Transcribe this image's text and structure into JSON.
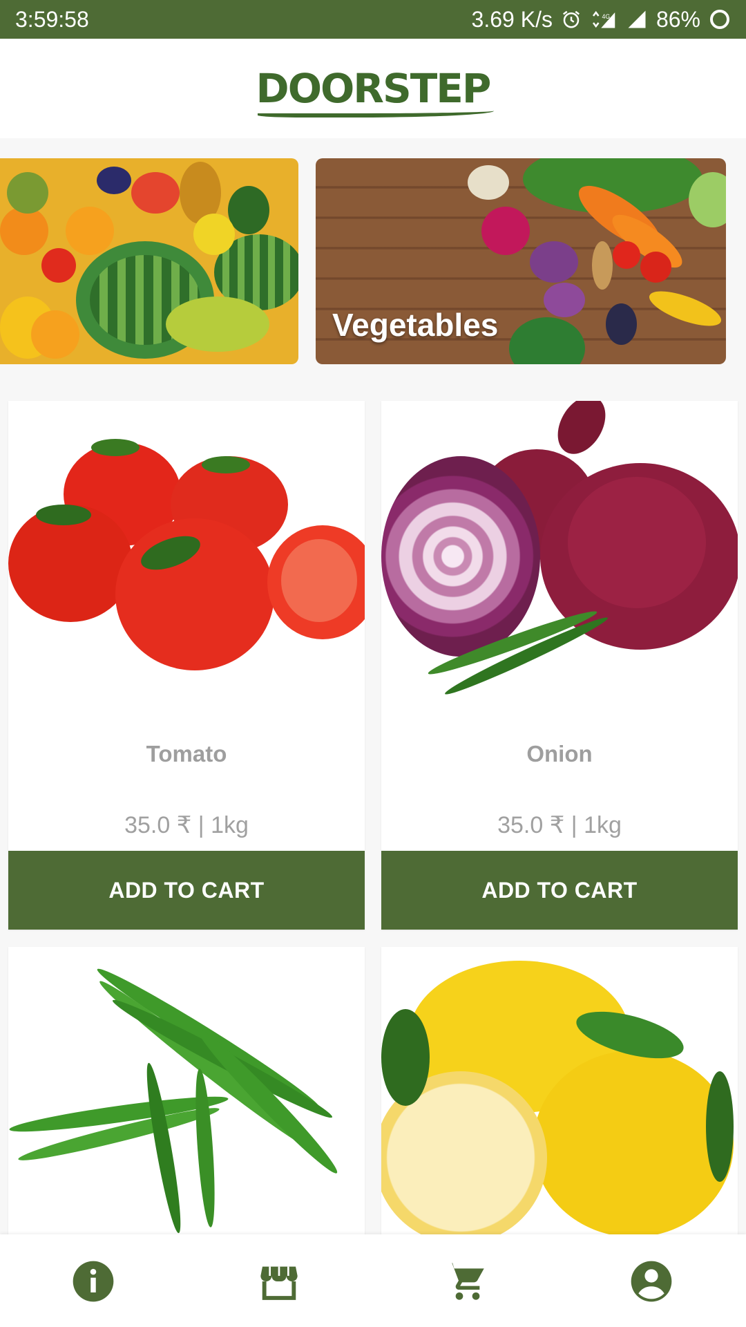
{
  "status_bar": {
    "time": "3:59:58",
    "speed": "3.69 K/s",
    "battery": "86%",
    "icons": [
      "alarm-icon",
      "data-4g-icon",
      "signal-icon",
      "signal-icon",
      "battery-icon"
    ]
  },
  "header": {
    "logo_text": "DOORSTEP"
  },
  "categories": [
    {
      "label": "",
      "icon": "fruits-image"
    },
    {
      "label": "Vegetables",
      "icon": "vegetables-image"
    }
  ],
  "products": [
    {
      "name": "Tomato",
      "price": "35.0 ₹  | 1kg",
      "button": "ADD TO CART",
      "icon": "tomato-image"
    },
    {
      "name": "Onion",
      "price": "35.0 ₹  | 1kg",
      "button": "ADD TO CART",
      "icon": "onion-image"
    },
    {
      "name": "",
      "price": "",
      "button": "",
      "icon": "green-chilli-image"
    },
    {
      "name": "",
      "price": "",
      "button": "",
      "icon": "lemon-image"
    }
  ],
  "bottom_nav": [
    {
      "icon": "info-icon"
    },
    {
      "icon": "store-icon"
    },
    {
      "icon": "cart-icon"
    },
    {
      "icon": "account-icon"
    }
  ],
  "colors": {
    "brand_green": "#4e6b35",
    "logo_green": "#3f6a2c",
    "muted_text": "#9e9e9e"
  }
}
